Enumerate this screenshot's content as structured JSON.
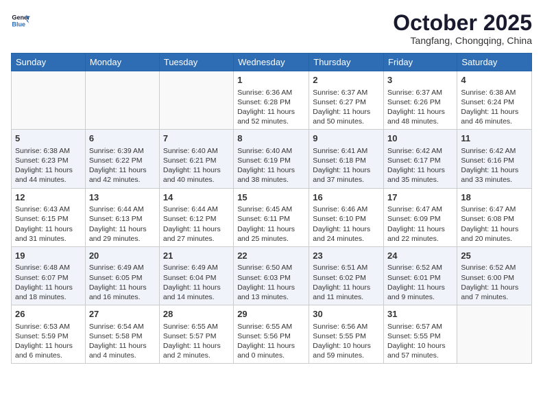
{
  "logo": {
    "line1": "General",
    "line2": "Blue"
  },
  "title": "October 2025",
  "location": "Tangfang, Chongqing, China",
  "days_header": [
    "Sunday",
    "Monday",
    "Tuesday",
    "Wednesday",
    "Thursday",
    "Friday",
    "Saturday"
  ],
  "weeks": [
    [
      {
        "day": "",
        "info": ""
      },
      {
        "day": "",
        "info": ""
      },
      {
        "day": "",
        "info": ""
      },
      {
        "day": "1",
        "info": "Sunrise: 6:36 AM\nSunset: 6:28 PM\nDaylight: 11 hours\nand 52 minutes."
      },
      {
        "day": "2",
        "info": "Sunrise: 6:37 AM\nSunset: 6:27 PM\nDaylight: 11 hours\nand 50 minutes."
      },
      {
        "day": "3",
        "info": "Sunrise: 6:37 AM\nSunset: 6:26 PM\nDaylight: 11 hours\nand 48 minutes."
      },
      {
        "day": "4",
        "info": "Sunrise: 6:38 AM\nSunset: 6:24 PM\nDaylight: 11 hours\nand 46 minutes."
      }
    ],
    [
      {
        "day": "5",
        "info": "Sunrise: 6:38 AM\nSunset: 6:23 PM\nDaylight: 11 hours\nand 44 minutes."
      },
      {
        "day": "6",
        "info": "Sunrise: 6:39 AM\nSunset: 6:22 PM\nDaylight: 11 hours\nand 42 minutes."
      },
      {
        "day": "7",
        "info": "Sunrise: 6:40 AM\nSunset: 6:21 PM\nDaylight: 11 hours\nand 40 minutes."
      },
      {
        "day": "8",
        "info": "Sunrise: 6:40 AM\nSunset: 6:19 PM\nDaylight: 11 hours\nand 38 minutes."
      },
      {
        "day": "9",
        "info": "Sunrise: 6:41 AM\nSunset: 6:18 PM\nDaylight: 11 hours\nand 37 minutes."
      },
      {
        "day": "10",
        "info": "Sunrise: 6:42 AM\nSunset: 6:17 PM\nDaylight: 11 hours\nand 35 minutes."
      },
      {
        "day": "11",
        "info": "Sunrise: 6:42 AM\nSunset: 6:16 PM\nDaylight: 11 hours\nand 33 minutes."
      }
    ],
    [
      {
        "day": "12",
        "info": "Sunrise: 6:43 AM\nSunset: 6:15 PM\nDaylight: 11 hours\nand 31 minutes."
      },
      {
        "day": "13",
        "info": "Sunrise: 6:44 AM\nSunset: 6:13 PM\nDaylight: 11 hours\nand 29 minutes."
      },
      {
        "day": "14",
        "info": "Sunrise: 6:44 AM\nSunset: 6:12 PM\nDaylight: 11 hours\nand 27 minutes."
      },
      {
        "day": "15",
        "info": "Sunrise: 6:45 AM\nSunset: 6:11 PM\nDaylight: 11 hours\nand 25 minutes."
      },
      {
        "day": "16",
        "info": "Sunrise: 6:46 AM\nSunset: 6:10 PM\nDaylight: 11 hours\nand 24 minutes."
      },
      {
        "day": "17",
        "info": "Sunrise: 6:47 AM\nSunset: 6:09 PM\nDaylight: 11 hours\nand 22 minutes."
      },
      {
        "day": "18",
        "info": "Sunrise: 6:47 AM\nSunset: 6:08 PM\nDaylight: 11 hours\nand 20 minutes."
      }
    ],
    [
      {
        "day": "19",
        "info": "Sunrise: 6:48 AM\nSunset: 6:07 PM\nDaylight: 11 hours\nand 18 minutes."
      },
      {
        "day": "20",
        "info": "Sunrise: 6:49 AM\nSunset: 6:05 PM\nDaylight: 11 hours\nand 16 minutes."
      },
      {
        "day": "21",
        "info": "Sunrise: 6:49 AM\nSunset: 6:04 PM\nDaylight: 11 hours\nand 14 minutes."
      },
      {
        "day": "22",
        "info": "Sunrise: 6:50 AM\nSunset: 6:03 PM\nDaylight: 11 hours\nand 13 minutes."
      },
      {
        "day": "23",
        "info": "Sunrise: 6:51 AM\nSunset: 6:02 PM\nDaylight: 11 hours\nand 11 minutes."
      },
      {
        "day": "24",
        "info": "Sunrise: 6:52 AM\nSunset: 6:01 PM\nDaylight: 11 hours\nand 9 minutes."
      },
      {
        "day": "25",
        "info": "Sunrise: 6:52 AM\nSunset: 6:00 PM\nDaylight: 11 hours\nand 7 minutes."
      }
    ],
    [
      {
        "day": "26",
        "info": "Sunrise: 6:53 AM\nSunset: 5:59 PM\nDaylight: 11 hours\nand 6 minutes."
      },
      {
        "day": "27",
        "info": "Sunrise: 6:54 AM\nSunset: 5:58 PM\nDaylight: 11 hours\nand 4 minutes."
      },
      {
        "day": "28",
        "info": "Sunrise: 6:55 AM\nSunset: 5:57 PM\nDaylight: 11 hours\nand 2 minutes."
      },
      {
        "day": "29",
        "info": "Sunrise: 6:55 AM\nSunset: 5:56 PM\nDaylight: 11 hours\nand 0 minutes."
      },
      {
        "day": "30",
        "info": "Sunrise: 6:56 AM\nSunset: 5:55 PM\nDaylight: 10 hours\nand 59 minutes."
      },
      {
        "day": "31",
        "info": "Sunrise: 6:57 AM\nSunset: 5:55 PM\nDaylight: 10 hours\nand 57 minutes."
      },
      {
        "day": "",
        "info": ""
      }
    ]
  ]
}
